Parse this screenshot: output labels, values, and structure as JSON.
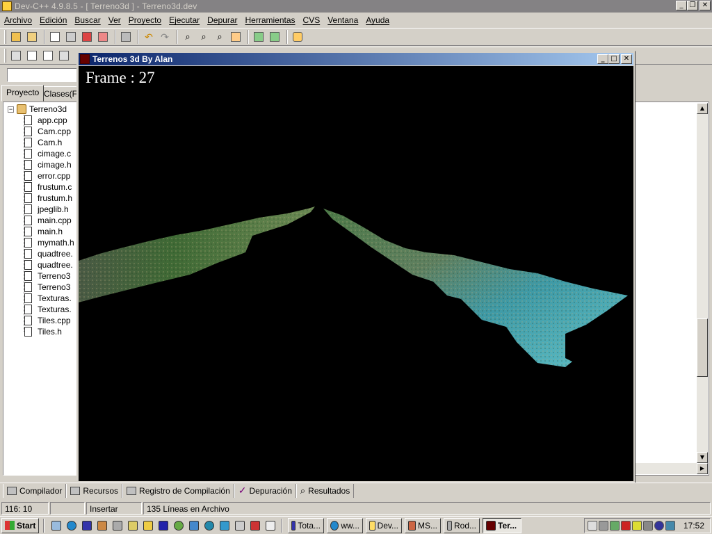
{
  "window": {
    "title": "Dev-C++ 4.9.8.5  -  [ Terreno3d ] - Terreno3d.dev",
    "buttons": {
      "minimize": "_",
      "maximize": "❐",
      "close": "✕"
    }
  },
  "menu": [
    "Archivo",
    "Edición",
    "Buscar",
    "Ver",
    "Proyecto",
    "Ejecutar",
    "Depurar",
    "Herramientas",
    "CVS",
    "Ventana",
    "Ayuda"
  ],
  "left_panel": {
    "tabs": [
      "Proyecto",
      "Clases(Fu"
    ],
    "project": "Terreno3d",
    "files": [
      "app.cpp",
      "Cam.cpp",
      "Cam.h",
      "cimage.c",
      "cimage.h",
      "error.cpp",
      "frustum.c",
      "frustum.h",
      "jpeglib.h",
      "main.cpp",
      "main.h",
      "mymath.h",
      "quadtree.",
      "quadtree.",
      "Terreno3",
      "Terreno3",
      "Texturas.",
      "Texturas.",
      "Tiles.cpp",
      "Tiles.h"
    ]
  },
  "child_window": {
    "title": "Terrenos 3d By Alan",
    "frame_label": "Frame : 27"
  },
  "bottom_tabs": [
    "Compilador",
    "Recursos",
    "Registro de Compilación",
    "Depuración",
    "Resultados"
  ],
  "status": {
    "position": "116: 10",
    "blank": "",
    "mode": "Insertar",
    "lines": "135 Líneas en Archivo"
  },
  "taskbar": {
    "start": "Start",
    "tasks": [
      "Tota...",
      "ww...",
      "Dev...",
      "MS...",
      "Rod...",
      "Ter..."
    ],
    "clock": "17:52"
  },
  "colors": {
    "active_title": "#0a246a",
    "inactive_title": "#848284",
    "face": "#d4d0c8"
  }
}
